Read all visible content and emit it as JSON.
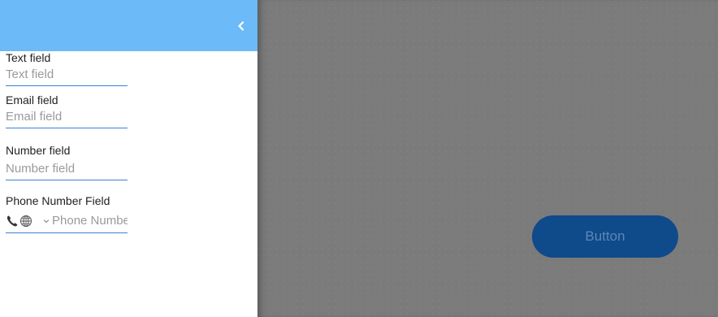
{
  "drawer": {
    "header_color": "#6cbaf8",
    "collapse_icon": "chevron-left-icon"
  },
  "form": {
    "text_field": {
      "label": "Text field",
      "placeholder": "Text field"
    },
    "email_field": {
      "label": "Email field",
      "placeholder": "Email field"
    },
    "number_field": {
      "label": "Number field",
      "placeholder": "Number field"
    },
    "phone_field": {
      "label": "Phone Number Field",
      "placeholder": "Phone Number",
      "phone_icon": "phone-icon",
      "globe_icon": "globe-icon",
      "dropdown_icon": "chevron-down-icon"
    }
  },
  "canvas": {
    "background_color": "#7b7b7b",
    "button": {
      "label": "Button",
      "color": "#0f4a8a"
    }
  }
}
